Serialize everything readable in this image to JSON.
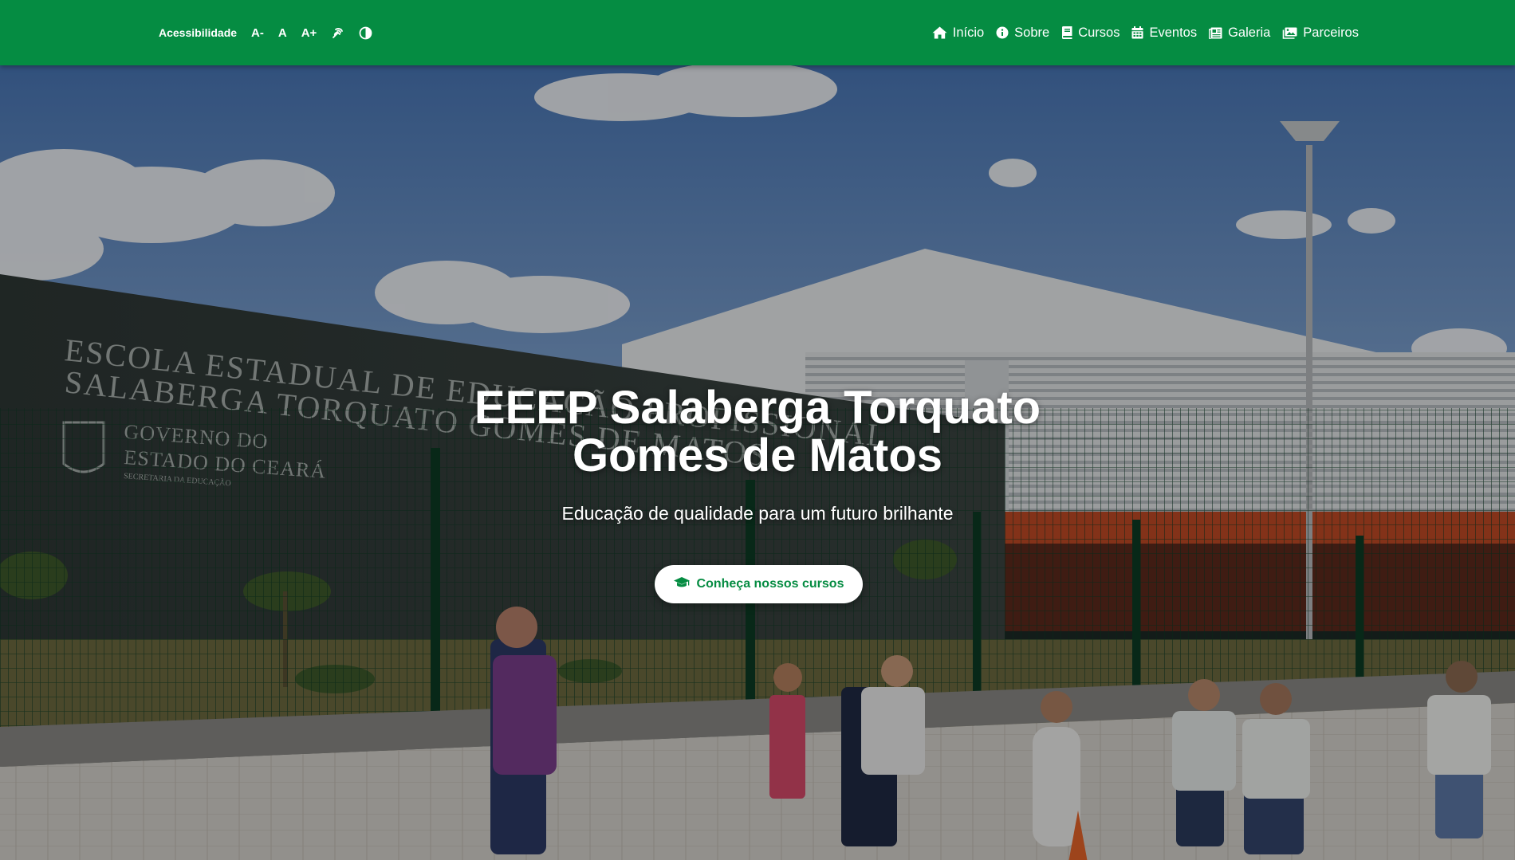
{
  "accessibility": {
    "label": "Acessibilidade",
    "decrease": "A-",
    "reset": "A",
    "increase": "A+",
    "sign_language_icon": "sign-language-icon",
    "contrast_icon": "contrast-icon"
  },
  "nav": {
    "items": [
      {
        "label": "Início",
        "icon": "home-icon"
      },
      {
        "label": "Sobre",
        "icon": "info-circle-icon"
      },
      {
        "label": "Cursos",
        "icon": "book-icon"
      },
      {
        "label": "Eventos",
        "icon": "calendar-icon"
      },
      {
        "label": "Galeria",
        "icon": "newspaper-icon"
      },
      {
        "label": "Parceiros",
        "icon": "images-icon"
      }
    ]
  },
  "hero": {
    "title_line1": "EEEP Salaberga Torquato",
    "title_line2": "Gomes de Matos",
    "subtitle": "Educação de qualidade para um futuro brilhante",
    "cta_label": "Conheça nossos cursos",
    "cta_icon": "graduation-cap-icon",
    "background_image": {
      "wall_sign_line1": "ESCOLA ESTADUAL DE EDUCAÇÃO PROFISSIONAL",
      "wall_sign_line2": "SALABERGA TORQUATO GOMES DE MATOS",
      "emblem_line1": "GOVERNO DO",
      "emblem_line2": "ESTADO DO CEARÁ",
      "emblem_line3": "SECRETARIA DA EDUCAÇÃO"
    }
  },
  "colors": {
    "brand_green": "#058c42",
    "white": "#ffffff"
  }
}
